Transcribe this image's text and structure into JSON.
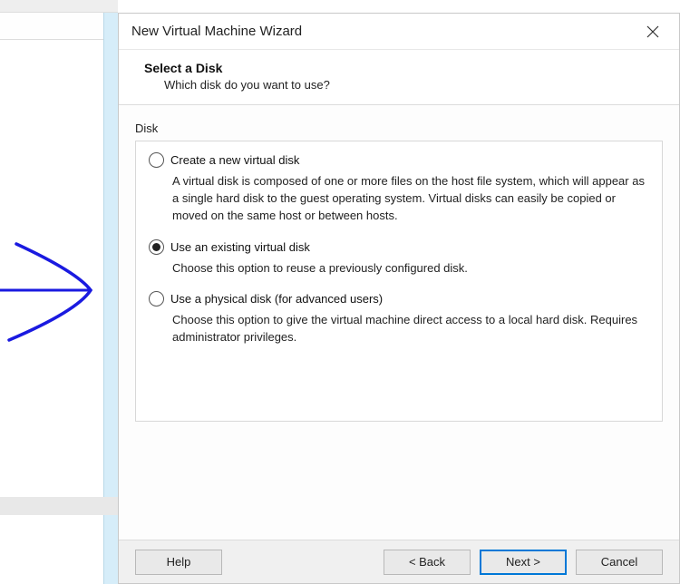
{
  "dialog": {
    "title": "New Virtual Machine Wizard",
    "header_title": "Select a Disk",
    "header_subtitle": "Which disk do you want to use?",
    "group_label": "Disk",
    "selected_option": 1,
    "options": [
      {
        "label": "Create a new virtual disk",
        "description": "A virtual disk is composed of one or more files on the host file system, which will appear as a single hard disk to the guest operating system. Virtual disks can easily be copied or moved on the same host or between hosts."
      },
      {
        "label": "Use an existing virtual disk",
        "description": "Choose this option to reuse a previously configured disk."
      },
      {
        "label": "Use a physical disk (for advanced users)",
        "description": "Choose this option to give the virtual machine direct access to a local hard disk. Requires administrator privileges."
      }
    ],
    "buttons": {
      "help": "Help",
      "back": "< Back",
      "next": "Next >",
      "cancel": "Cancel"
    }
  },
  "annotation": {
    "arrow_color": "#1a1ae0"
  }
}
